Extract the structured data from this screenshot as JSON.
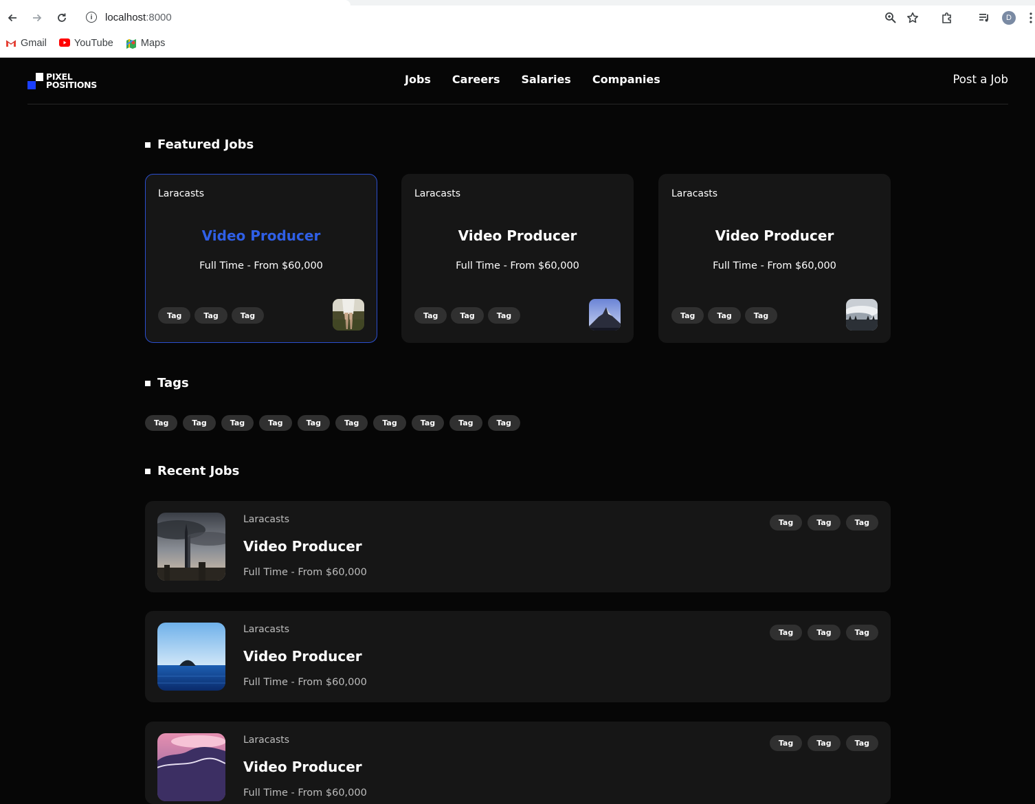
{
  "browser": {
    "url_host": "localhost",
    "url_port": ":8000",
    "avatar_letter": "D",
    "bookmarks": [
      {
        "label": "Gmail",
        "icon": "gmail-icon"
      },
      {
        "label": "YouTube",
        "icon": "youtube-icon"
      },
      {
        "label": "Maps",
        "icon": "maps-icon"
      }
    ]
  },
  "site": {
    "logo_line1": "PIXEL",
    "logo_line2": "POSITIONS",
    "nav": [
      "Jobs",
      "Careers",
      "Salaries",
      "Companies"
    ],
    "post_job": "Post a Job",
    "colors": {
      "background": "#060606",
      "card": "#161616",
      "accent": "#2f5fe6",
      "tag": "#303030"
    }
  },
  "featured": {
    "heading": "Featured Jobs",
    "jobs": [
      {
        "company": "Laracasts",
        "title": "Video Producer",
        "meta": "Full Time - From $60,000",
        "tags": [
          "Tag",
          "Tag",
          "Tag"
        ],
        "image": "person-legs-photo"
      },
      {
        "company": "Laracasts",
        "title": "Video Producer",
        "meta": "Full Time - From $60,000",
        "tags": [
          "Tag",
          "Tag",
          "Tag"
        ],
        "image": "mountain-peak-photo"
      },
      {
        "company": "Laracasts",
        "title": "Video Producer",
        "meta": "Full Time - From $60,000",
        "tags": [
          "Tag",
          "Tag",
          "Tag"
        ],
        "image": "misty-forest-photo"
      }
    ]
  },
  "tags_section": {
    "heading": "Tags",
    "tags": [
      "Tag",
      "Tag",
      "Tag",
      "Tag",
      "Tag",
      "Tag",
      "Tag",
      "Tag",
      "Tag",
      "Tag"
    ]
  },
  "recent": {
    "heading": "Recent Jobs",
    "jobs": [
      {
        "company": "Laracasts",
        "title": "Video Producer",
        "meta": "Full Time - From $60,000",
        "tags": [
          "Tag",
          "Tag",
          "Tag"
        ],
        "image": "skyscraper-photo"
      },
      {
        "company": "Laracasts",
        "title": "Video Producer",
        "meta": "Full Time - From $60,000",
        "tags": [
          "Tag",
          "Tag",
          "Tag"
        ],
        "image": "ocean-island-photo"
      },
      {
        "company": "Laracasts",
        "title": "Video Producer",
        "meta": "Full Time - From $60,000",
        "tags": [
          "Tag",
          "Tag",
          "Tag"
        ],
        "image": "pink-clouds-photo"
      }
    ]
  }
}
